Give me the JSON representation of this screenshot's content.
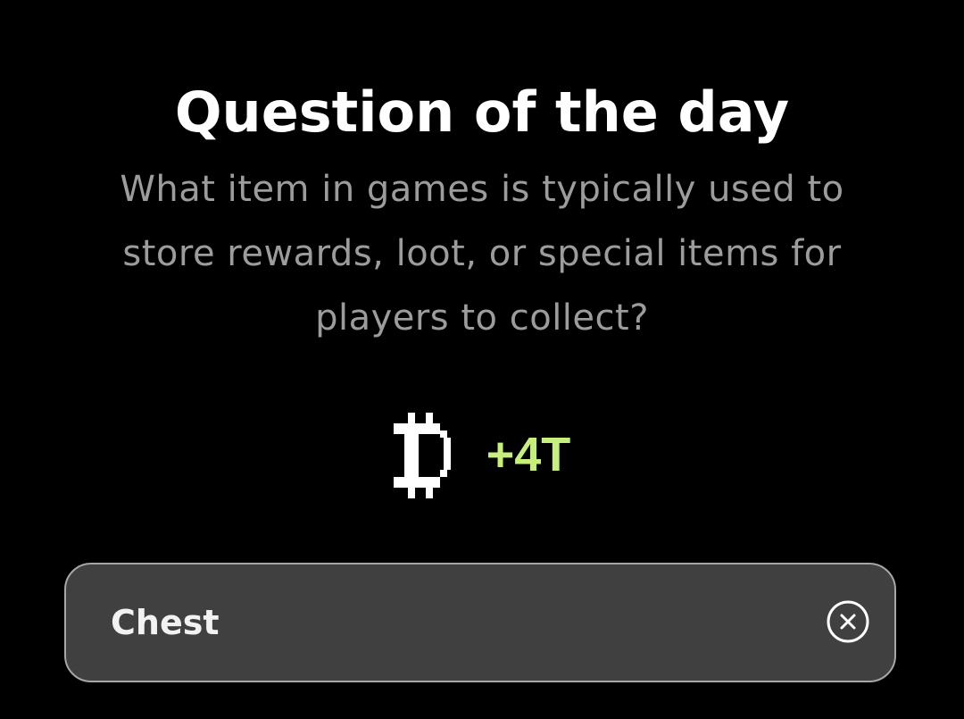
{
  "quiz": {
    "title": "Question of the day",
    "question": "What item in games is typically used to store rewards, loot, or special items for players to collect?"
  },
  "reward": {
    "icon": "pixel-coin-icon",
    "amount": "+4T",
    "amount_color": "#c6ef7c"
  },
  "answer": {
    "value": "Chest",
    "clear_icon": "close-circle-icon"
  },
  "colors": {
    "background": "#000000",
    "title": "#ffffff",
    "question": "#9c9c9c",
    "field_background": "#404040",
    "field_border": "#a7a7a7"
  }
}
